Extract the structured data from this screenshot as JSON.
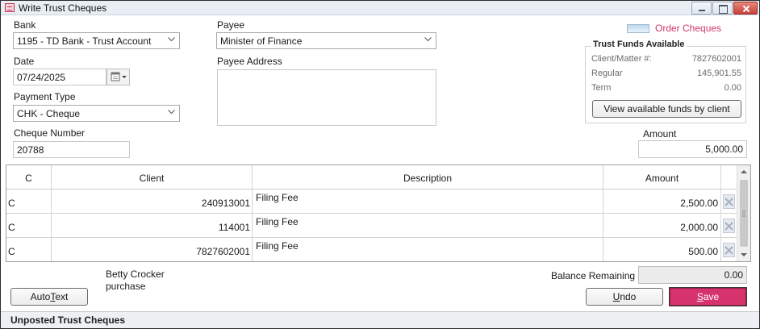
{
  "window": {
    "title": "Write Trust Cheques"
  },
  "bank": {
    "label": "Bank",
    "value": "1195 - TD Bank - Trust Account"
  },
  "date": {
    "label": "Date",
    "value": "07/24/2025"
  },
  "payment_type": {
    "label": "Payment Type",
    "value": "CHK - Cheque"
  },
  "cheque_number": {
    "label": "Cheque Number",
    "value": "20788"
  },
  "payee": {
    "label": "Payee",
    "value": "Minister of Finance"
  },
  "payee_address": {
    "label": "Payee Address",
    "value": ""
  },
  "order_cheques": {
    "label": "Order Cheques"
  },
  "trust_funds": {
    "title": "Trust Funds Available",
    "client_matter_label": "Client/Matter #:",
    "client_matter_value": "7827602001",
    "regular_label": "Regular",
    "regular_value": "145,901.55",
    "term_label": "Term",
    "term_value": "0.00",
    "view_button": "View available funds by client"
  },
  "amount": {
    "label": "Amount",
    "value": "5,000.00"
  },
  "grid": {
    "columns": [
      "C",
      "Client",
      "Description",
      "Amount"
    ],
    "rows": [
      {
        "c": "C",
        "client": "240913001",
        "description": "Filing Fee",
        "amount": "2,500.00"
      },
      {
        "c": "C",
        "client": "114001",
        "description": "Filing Fee",
        "amount": "2,000.00"
      },
      {
        "c": "C",
        "client": "7827602001",
        "description": "Filing Fee",
        "amount": "500.00"
      }
    ]
  },
  "memo": {
    "line1": "Betty Crocker",
    "line2": "purchase"
  },
  "autotext": {
    "pre": "Auto",
    "hotkey": "T",
    "post": "ext"
  },
  "balance": {
    "label": "Balance Remaining",
    "value": "0.00"
  },
  "undo": {
    "hotkey": "U",
    "post": "ndo"
  },
  "save": {
    "hotkey": "S",
    "post": "ave"
  },
  "footer": {
    "label": "Unposted Trust Cheques"
  },
  "colors": {
    "accent": "#d6336c",
    "link": "#d2366a"
  }
}
